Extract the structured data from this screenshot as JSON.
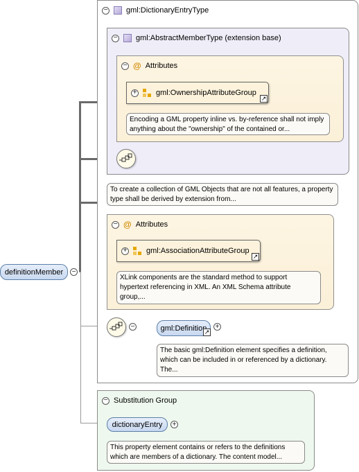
{
  "outer_type": {
    "label": "gml:DictionaryEntryType"
  },
  "base_type": {
    "label": "gml:AbstractMemberType (extension base)"
  },
  "attributes_1": {
    "label": "Attributes",
    "group": "gml:OwnershipAttributeGroup",
    "note": "Encoding a GML property inline vs. by-reference shall not imply anything about the \"ownership\" of the contained or..."
  },
  "base_note": "To create a collection of GML Objects that are not all features, a property type shall be derived by extension from...",
  "attributes_2": {
    "label": "Attributes",
    "group": "gml:AssociationAttributeGroup",
    "note": "XLink components are the standard method to support hypertext referencing in XML. An XML Schema attribute group,..."
  },
  "definition_element": {
    "label": "gml:Definition",
    "note": "The basic gml:Definition element specifies a definition, which can be included in or referenced by a dictionary. The..."
  },
  "root_element": {
    "label": "definitionMember"
  },
  "substitution_group": {
    "label": "Substitution Group",
    "element": "dictionaryEntry",
    "note": "This property element contains or refers to the definitions which are members of a dictionary. The content model..."
  }
}
